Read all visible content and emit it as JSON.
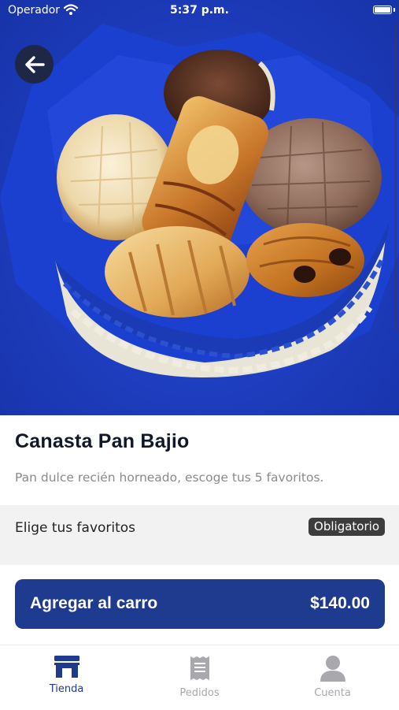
{
  "status_bar": {
    "carrier": "Operador",
    "time": "5:37 p.m."
  },
  "product": {
    "title": "Canasta Pan Bajio",
    "description": "Pan dulce recién horneado, escoge tus 5 favoritos."
  },
  "options_section": {
    "label": "Elige tus favoritos",
    "badge": "Obligatorio"
  },
  "cart_button": {
    "label": "Agregar al carro",
    "price": "$140.00"
  },
  "tab_bar": {
    "tabs": [
      {
        "label": "Tienda",
        "icon": "store-icon",
        "active": true
      },
      {
        "label": "Pedidos",
        "icon": "receipt-icon",
        "active": false
      },
      {
        "label": "Cuenta",
        "icon": "person-icon",
        "active": false
      }
    ]
  },
  "colors": {
    "primary": "#1e3b8f",
    "badge_bg": "#3d3d3d",
    "hero_bg": "#1f3fc2"
  }
}
